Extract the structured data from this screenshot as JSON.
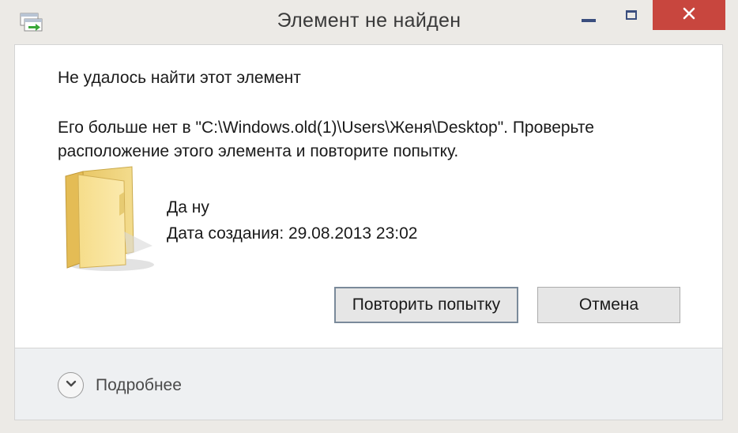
{
  "window": {
    "title": "Элемент не найден",
    "controls": [
      "minimize-icon",
      "maximize-icon",
      "close-icon"
    ]
  },
  "dialog": {
    "heading": "Не удалось найти этот элемент",
    "message": "Его больше нет в \"C:\\Windows.old(1)\\Users\\Женя\\Desktop\". Проверьте расположение этого элемента и повторите попытку.",
    "item": {
      "icon": "folder-icon",
      "name": "Да ну",
      "created": "Дата создания: 29.08.2013 23:02"
    },
    "buttons": {
      "retry_label": "Повторить попытку",
      "cancel_label": "Отмена"
    }
  },
  "footer": {
    "details_label": "Подробнее",
    "details_icon": "chevron-down-icon"
  },
  "colors": {
    "close_button": "#c8463e",
    "frame": "#eceae6",
    "content_bg": "#ffffff",
    "footer_bg": "#eef0f2"
  }
}
